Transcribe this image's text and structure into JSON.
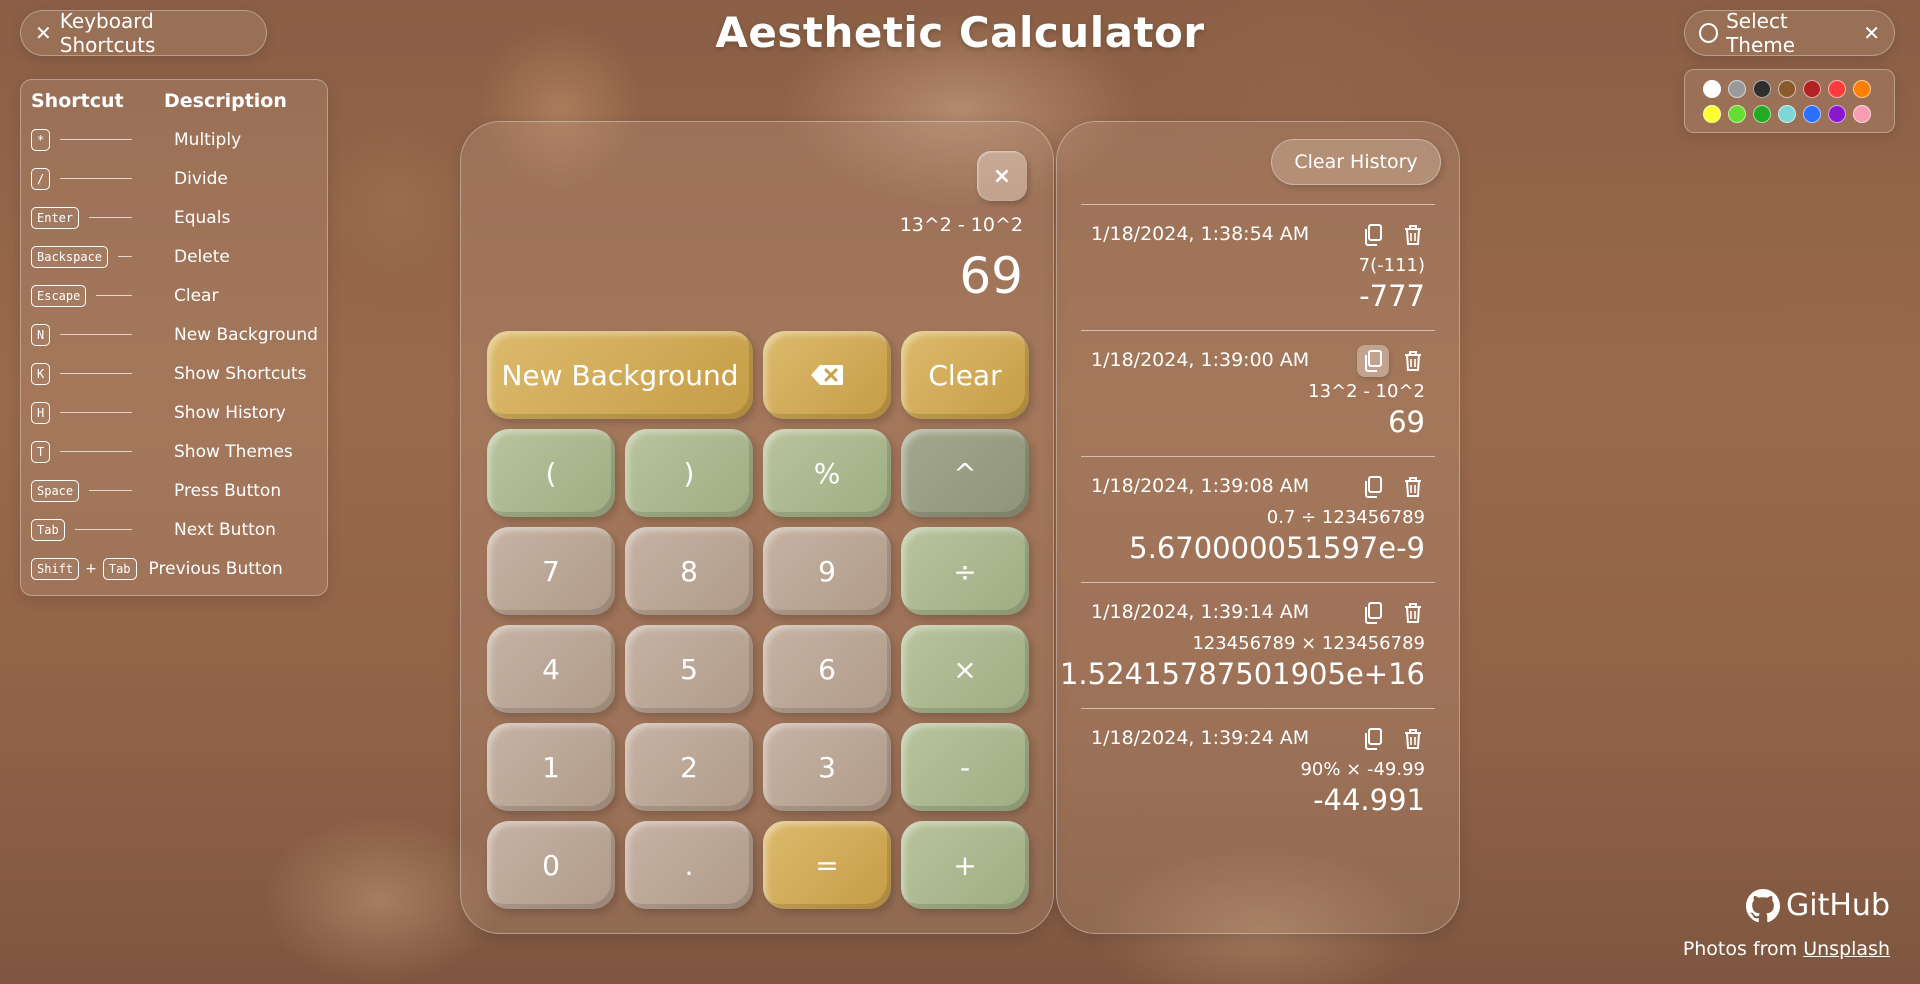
{
  "app_title": "Aesthetic Calculator",
  "keyboard_toggle": {
    "label": "Keyboard Shortcuts"
  },
  "theme_toggle": {
    "label": "Select Theme"
  },
  "shortcuts": {
    "header_shortcut": "Shortcut",
    "header_description": "Description",
    "rows": [
      {
        "keys": [
          "*"
        ],
        "description": "Multiply"
      },
      {
        "keys": [
          "/"
        ],
        "description": "Divide"
      },
      {
        "keys": [
          "Enter"
        ],
        "description": "Equals"
      },
      {
        "keys": [
          "Backspace"
        ],
        "description": "Delete"
      },
      {
        "keys": [
          "Escape"
        ],
        "description": "Clear"
      },
      {
        "keys": [
          "N"
        ],
        "description": "New Background"
      },
      {
        "keys": [
          "K"
        ],
        "description": "Show Shortcuts"
      },
      {
        "keys": [
          "H"
        ],
        "description": "Show History"
      },
      {
        "keys": [
          "T"
        ],
        "description": "Show Themes"
      },
      {
        "keys": [
          "Space"
        ],
        "description": "Press Button"
      },
      {
        "keys": [
          "Tab"
        ],
        "description": "Next Button"
      },
      {
        "keys": [
          "Shift",
          "Tab"
        ],
        "plus": "+",
        "description": "Previous Button"
      }
    ]
  },
  "themes": {
    "colors": [
      "#ffffff",
      "#9a9a9a",
      "#2e2e2e",
      "#8b5a2b",
      "#b22222",
      "#ff3b3b",
      "#ff7f00",
      "#ffff33",
      "#66dd33",
      "#22aa22",
      "#7ed6d6",
      "#2a70ff",
      "#8a16cf",
      "#f79cb1"
    ]
  },
  "calculator": {
    "expression": "13^2 - 10^2",
    "result": "69",
    "close_label": "×",
    "buttons": {
      "new_background": "New Background",
      "clear": "Clear",
      "open_paren": "(",
      "close_paren": ")",
      "percent": "%",
      "power": "^",
      "seven": "7",
      "eight": "8",
      "nine": "9",
      "divide": "÷",
      "four": "4",
      "five": "5",
      "six": "6",
      "multiply": "×",
      "one": "1",
      "two": "2",
      "three": "3",
      "minus": "-",
      "zero": "0",
      "decimal": ".",
      "equals": "=",
      "plus": "+"
    }
  },
  "history": {
    "clear_label": "Clear History",
    "items": [
      {
        "date": "1/18/2024, 1:38:54 AM",
        "expression": "7(-111)",
        "result": "-777"
      },
      {
        "date": "1/18/2024, 1:39:00 AM",
        "expression": "13^2 - 10^2",
        "result": "69"
      },
      {
        "date": "1/18/2024, 1:39:08 AM",
        "expression": "0.7 ÷ 123456789",
        "result": "5.670000051597e-9"
      },
      {
        "date": "1/18/2024, 1:39:14 AM",
        "expression": "123456789 × 123456789",
        "result": "1.5241578750190 5e+16"
      },
      {
        "date": "1/18/2024, 1:39:24 AM",
        "expression": "90% × -49.99",
        "result": "-44.991"
      }
    ]
  },
  "footer": {
    "github_label": "GitHub",
    "photos_prefix": "Photos from ",
    "photos_link": "Unsplash"
  }
}
